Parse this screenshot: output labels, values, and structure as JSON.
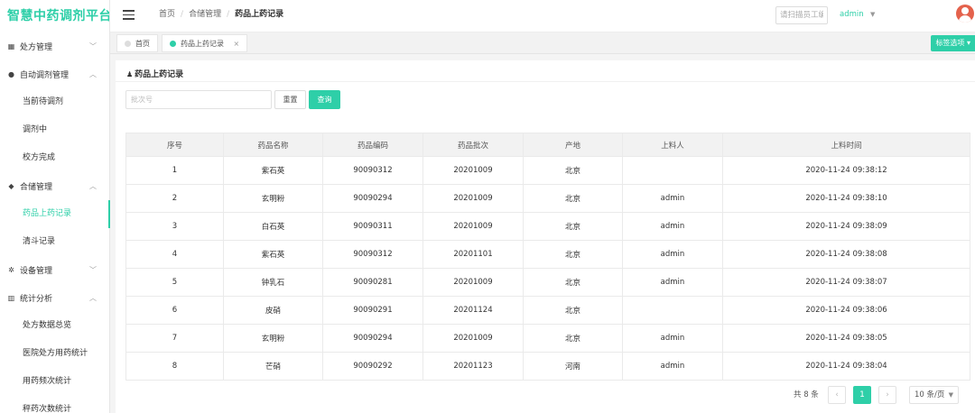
{
  "app": {
    "logo": "智慧中药调剂平台"
  },
  "sidebar": {
    "groups": [
      {
        "label": "处方管理",
        "icon": "document-icon",
        "glyph": "▦",
        "arrow": "﹀"
      },
      {
        "label": "自动调剂管理",
        "icon": "gear-dot-icon",
        "glyph": "●",
        "arrow": "︿",
        "items": [
          {
            "label": "当前待调剂"
          },
          {
            "label": "调剂中"
          },
          {
            "label": "校方完成"
          }
        ]
      },
      {
        "label": "合储管理",
        "icon": "drop-icon",
        "glyph": "◆",
        "arrow": "︿",
        "items": [
          {
            "label": "药品上药记录"
          },
          {
            "label": "清斗记录"
          }
        ]
      },
      {
        "label": "设备管理",
        "icon": "gear-icon",
        "glyph": "✲",
        "arrow": "﹀"
      },
      {
        "label": "统计分析",
        "icon": "bar-chart-icon",
        "glyph": "▥",
        "arrow": "︿",
        "items": [
          {
            "label": "处方数据总览"
          },
          {
            "label": "医院处方用药统计"
          },
          {
            "label": "用药频次统计"
          },
          {
            "label": "秤药次数统计"
          }
        ]
      }
    ]
  },
  "header": {
    "breadcrumb": {
      "home": "首页",
      "section": "合储管理",
      "current": "药品上药记录",
      "separator": "/"
    },
    "search_placeholder": "请扫描员工编号",
    "user": "admin",
    "user_caret": "▼"
  },
  "tabs": {
    "items": [
      {
        "label": "首页"
      },
      {
        "label": "药品上药记录",
        "close": "×"
      }
    ],
    "options_label": "标签选项 ▾"
  },
  "page": {
    "title": "药品上药记录",
    "title_icon": "♟",
    "filter": {
      "batch_placeholder": "批次号"
    },
    "buttons": {
      "reset": "重置",
      "query": "查询"
    },
    "table": {
      "columns": [
        "序号",
        "药品名称",
        "药品编码",
        "药品批次",
        "产地",
        "上料人",
        "上料时间"
      ],
      "rows": [
        [
          "1",
          "紫石英",
          "90090312",
          "20201009",
          "北京",
          "",
          "2020-11-24 09:38:12"
        ],
        [
          "2",
          "玄明粉",
          "90090294",
          "20201009",
          "北京",
          "admin",
          "2020-11-24 09:38:10"
        ],
        [
          "3",
          "白石英",
          "90090311",
          "20201009",
          "北京",
          "admin",
          "2020-11-24 09:38:09"
        ],
        [
          "4",
          "紫石英",
          "90090312",
          "20201101",
          "北京",
          "admin",
          "2020-11-24 09:38:08"
        ],
        [
          "5",
          "钟乳石",
          "90090281",
          "20201009",
          "北京",
          "admin",
          "2020-11-24 09:38:07"
        ],
        [
          "6",
          "皮硝",
          "90090291",
          "20201124",
          "北京",
          "",
          "2020-11-24 09:38:06"
        ],
        [
          "7",
          "玄明粉",
          "90090294",
          "20201009",
          "北京",
          "admin",
          "2020-11-24 09:38:05"
        ],
        [
          "8",
          "芒硝",
          "90090292",
          "20201123",
          "河南",
          "admin",
          "2020-11-24 09:38:04"
        ]
      ]
    },
    "pagination": {
      "total": "共 8 条",
      "prev": "‹",
      "current_page": "1",
      "next": "›",
      "page_size": "10 条/页",
      "caret": "▼"
    }
  },
  "colors": {
    "accent": "#2ecfa8",
    "avatar": "#e4624c"
  }
}
